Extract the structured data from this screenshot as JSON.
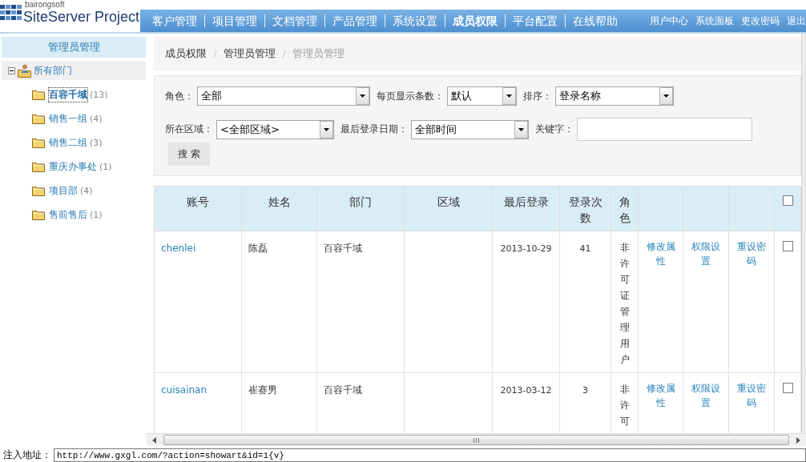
{
  "header": {
    "logo": {
      "tagline": "bairongsoft",
      "name": "SiteServer Project"
    },
    "nav": [
      {
        "label": "客户管理",
        "selected": false
      },
      {
        "label": "项目管理",
        "selected": false
      },
      {
        "label": "文档管理",
        "selected": false
      },
      {
        "label": "产品管理",
        "selected": false
      },
      {
        "label": "系统设置",
        "selected": false
      },
      {
        "label": "成员权限",
        "selected": true
      },
      {
        "label": "平台配置",
        "selected": false
      },
      {
        "label": "在线帮助",
        "selected": false
      }
    ],
    "user_links": [
      "用户中心",
      "系统面板",
      "更改密码",
      "退出"
    ]
  },
  "sidebar": {
    "title": "管理员管理",
    "tree": {
      "label": "所有部门",
      "expanded": true,
      "children": [
        {
          "label": "百容千域",
          "count": "(13)",
          "selected": true
        },
        {
          "label": "销售一组",
          "count": "(4)",
          "selected": false
        },
        {
          "label": "销售二组",
          "count": "(3)",
          "selected": false
        },
        {
          "label": "重庆办事处",
          "count": "(1)",
          "selected": false
        },
        {
          "label": "项目部",
          "count": "(4)",
          "selected": false
        },
        {
          "label": "售前售后",
          "count": "(1)",
          "selected": false
        }
      ]
    }
  },
  "breadcrumb": [
    {
      "label": "成员权限",
      "current": false
    },
    {
      "label": "管理员管理",
      "current": false
    },
    {
      "label": "管理员管理",
      "current": true
    }
  ],
  "filters": {
    "rows": [
      [
        {
          "kind": "select",
          "label": "角色：",
          "value": "全部"
        },
        {
          "kind": "select",
          "label": "每页显示条数：",
          "value": "默认"
        },
        {
          "kind": "select",
          "label": "排序：",
          "value": "登录名称"
        }
      ],
      [
        {
          "kind": "select",
          "label": "所在区域：",
          "value": "<全部区域>"
        },
        {
          "kind": "select",
          "label": "最后登录日期：",
          "value": "全部时间"
        },
        {
          "kind": "text",
          "label": "关键字："
        }
      ]
    ],
    "search_button": "搜 索"
  },
  "table": {
    "columns": [
      {
        "kind": "text",
        "label": "账号"
      },
      {
        "kind": "text",
        "label": "姓名"
      },
      {
        "kind": "text",
        "label": "部门"
      },
      {
        "kind": "text",
        "label": "区域"
      },
      {
        "kind": "text",
        "label": "最后登录"
      },
      {
        "kind": "text",
        "label": "登录次数"
      },
      {
        "kind": "vertical",
        "label": "角色"
      },
      {
        "kind": "blank"
      },
      {
        "kind": "blank"
      },
      {
        "kind": "blank"
      },
      {
        "kind": "checkbox",
        "checked": false
      }
    ],
    "rows": [
      {
        "account": "chenlei",
        "name": "陈磊",
        "department": "百容千域",
        "last_login": "2013-10-29",
        "login_count": "41",
        "role": "非许可证管理用户",
        "actions": [
          "修改属性",
          "权限设置",
          "重设密码"
        ],
        "checked": false
      },
      {
        "account": "cuisainan",
        "name": "崔赛男",
        "department": "百容千域",
        "last_login": "2013-03-12",
        "login_count": "3",
        "role": "非许可",
        "actions": [
          "修改属性",
          "权限设置",
          "重设密码"
        ],
        "checked": false
      }
    ]
  },
  "footer": {
    "label": "注入地址：",
    "value": "http://www.gxgl.com/?action=showart&id=1{v}"
  }
}
